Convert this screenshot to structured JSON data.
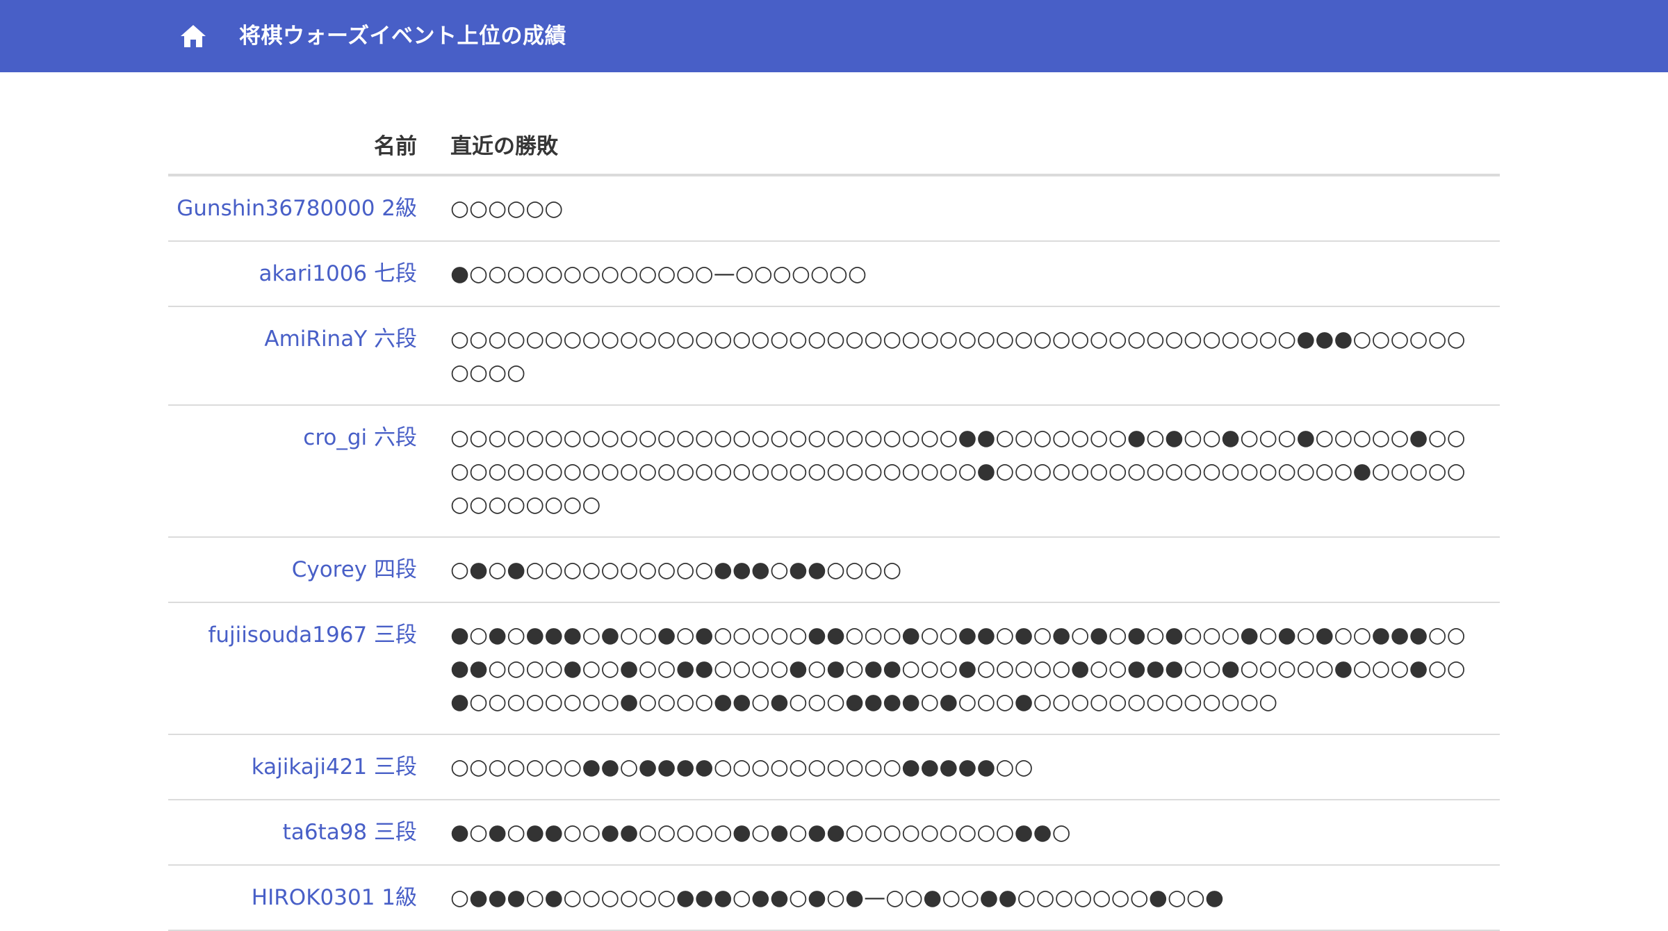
{
  "header": {
    "title": "将棋ウォーズイベント上位の成績",
    "home_icon": "home-icon",
    "background": "#485fc7"
  },
  "table": {
    "columns": {
      "name": "名前",
      "results": "直近の勝敗"
    },
    "rows": [
      {
        "player": "Gunshin36780000 2級",
        "results": "○○○○○○"
      },
      {
        "player": "akari1006 七段",
        "results": "●○○○○○○○○○○○○○—○○○○○○○"
      },
      {
        "player": "AmiRinaY 六段",
        "results": "○○○○○○○○○○○○○○○○○○○○○○○○○○○○○○○○○○○○○○○○○○○○○●●●○○○○○○○○○○"
      },
      {
        "player": "cro_gi 六段",
        "results": "○○○○○○○○○○○○○○○○○○○○○○○○○○○●●○○○○○○○●○●○○●○○○●○○○○○●○○○○○○○○○○○○○○○○○○○○○○○○○○○○○○●○○○○○○○○○○○○○○○○○○○●○○○○○○○○○○○○○"
      },
      {
        "player": "Cyorey 四段",
        "results": "○●○●○○○○○○○○○○●●●○●●○○○○"
      },
      {
        "player": "fujiisouda1967 三段",
        "results": "●○●○●●●○●○○●○●○○○○○●●○○○●○○●●○●○●○●○●○●○○○●○●○●○○●●●○○●●○○○○●○○●○○●●○○○○●○●○●●○○○●○○○○○●○○●●●○○●○○○○○●○○○●○○●○○○○○○○○●○○○○●●○●○○○●●●●○●○○○●○○○○○○○○○○○○○"
      },
      {
        "player": "kajikaji421 三段",
        "results": "○○○○○○○●●○●●●●○○○○○○○○○○●●●●●○○"
      },
      {
        "player": "ta6ta98 三段",
        "results": "●○●○●●○○●●○○○○○●○●○●●○○○○○○○○○●●○"
      },
      {
        "player": "HIROK0301 1級",
        "results": "○●●●○●○○○○○○●●●○●●○●○●—○○●○○●●○○○○○○○●○○●"
      }
    ]
  }
}
